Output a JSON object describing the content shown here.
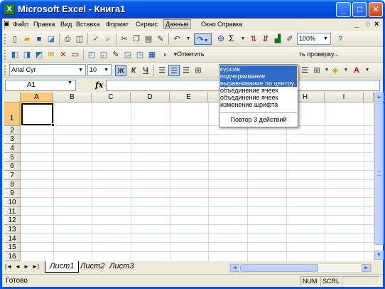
{
  "window": {
    "title": "Microsoft Excel - Книга1",
    "app_icon_letter": "X",
    "buttons": [
      "_",
      "□",
      "✕"
    ]
  },
  "menu": {
    "items": [
      "Файл",
      "Правка",
      "Вид",
      "Вставка",
      "Формат",
      "Сервис",
      "Данные",
      "Окно",
      "Справка"
    ],
    "active_item": "Данные",
    "doc_controls": [
      "_",
      "♢",
      "×"
    ]
  },
  "toolbar1": {
    "zoom": "100%",
    "sigma": "Σ"
  },
  "toolbar2": {
    "review_left": "Ответить",
    "review_right": "ть проверку..."
  },
  "format_toolbar": {
    "font_name": "Arial Cyr",
    "font_size": "10",
    "bold": "Ж",
    "italic": "К",
    "underline": "Ч"
  },
  "formula_bar": {
    "name_box": "A1",
    "fx": "fx",
    "value": ""
  },
  "grid": {
    "columns": [
      "A",
      "B",
      "C",
      "D",
      "E",
      "F",
      "G",
      "H",
      "I"
    ],
    "rows": [
      "1",
      "2",
      "3",
      "4",
      "5",
      "6",
      "7",
      "8",
      "9",
      "10",
      "11",
      "12",
      "13",
      "14",
      "15",
      "16"
    ],
    "selected_cell": "A1"
  },
  "sheets": {
    "tabs": [
      "Лист1",
      "Лист2",
      "Лист3"
    ],
    "active": "Лист1",
    "nav": [
      "|◄",
      "◄",
      "►",
      "►|"
    ]
  },
  "status": {
    "ready": "Готово",
    "num": "NUM",
    "scrl": "SCRL"
  },
  "undo_dropdown": {
    "items": [
      "курсив",
      "подчеркивание",
      "выравнивание по центру",
      "объединение ячеек",
      "объединение ячеек",
      "изменение шрифта"
    ],
    "highlighted_count": 3,
    "footer": "Повтор 3 действий"
  },
  "colors": {
    "title_blue": "#0453e0",
    "highlight": "#316ac5",
    "selected_header": "#f9c97e"
  }
}
